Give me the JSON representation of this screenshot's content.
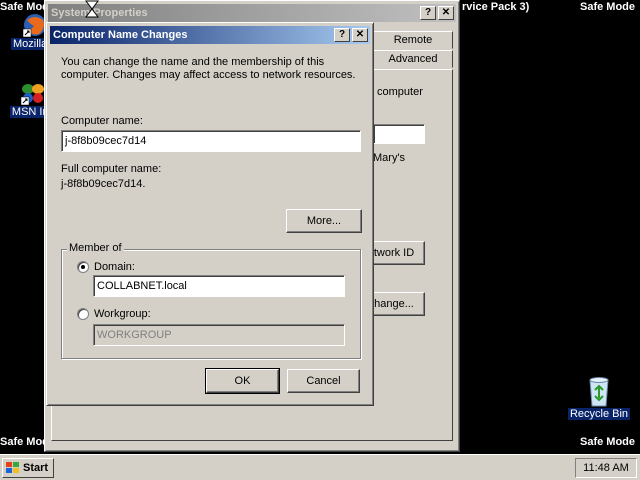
{
  "desktop": {
    "safe_mode_label": "Safe Mode",
    "service_pack_text": "rvice Pack 3)",
    "icons": [
      {
        "label": "Mozilla F",
        "icon": "firefox-icon"
      },
      {
        "label": "MSN Ins",
        "icon": "msn-butterfly-icon"
      },
      {
        "label": "Recycle Bin",
        "icon": "recycle-bin-icon"
      }
    ]
  },
  "system_properties": {
    "title": "System Properties",
    "tabs": [
      "Remote",
      "Advanced"
    ],
    "partial_texts": {
      "computer": "computer",
      "marys": "Mary's",
      "network_id_button": "twork ID",
      "change_button": "hange..."
    }
  },
  "dialog": {
    "title": "Computer Name Changes",
    "description_line1": "You can change the name and the membership of this",
    "description_line2": "computer. Changes may affect access to network resources.",
    "computer_name_label": "Computer name:",
    "computer_name_value": "j-8f8b09cec7d14",
    "full_name_label": "Full computer name:",
    "full_name_value": "j-8f8b09cec7d14.",
    "more_button": "More...",
    "member_of_label": "Member of",
    "domain_label": "Domain:",
    "domain_value": "COLLABNET.local",
    "workgroup_label": "Workgroup:",
    "workgroup_value": "WORKGROUP",
    "selected_membership": "Domain",
    "ok_button": "OK",
    "cancel_button": "Cancel",
    "help_button": "?",
    "close_button": "✕"
  },
  "taskbar": {
    "start_label": "Start",
    "clock": "11:48 AM"
  }
}
